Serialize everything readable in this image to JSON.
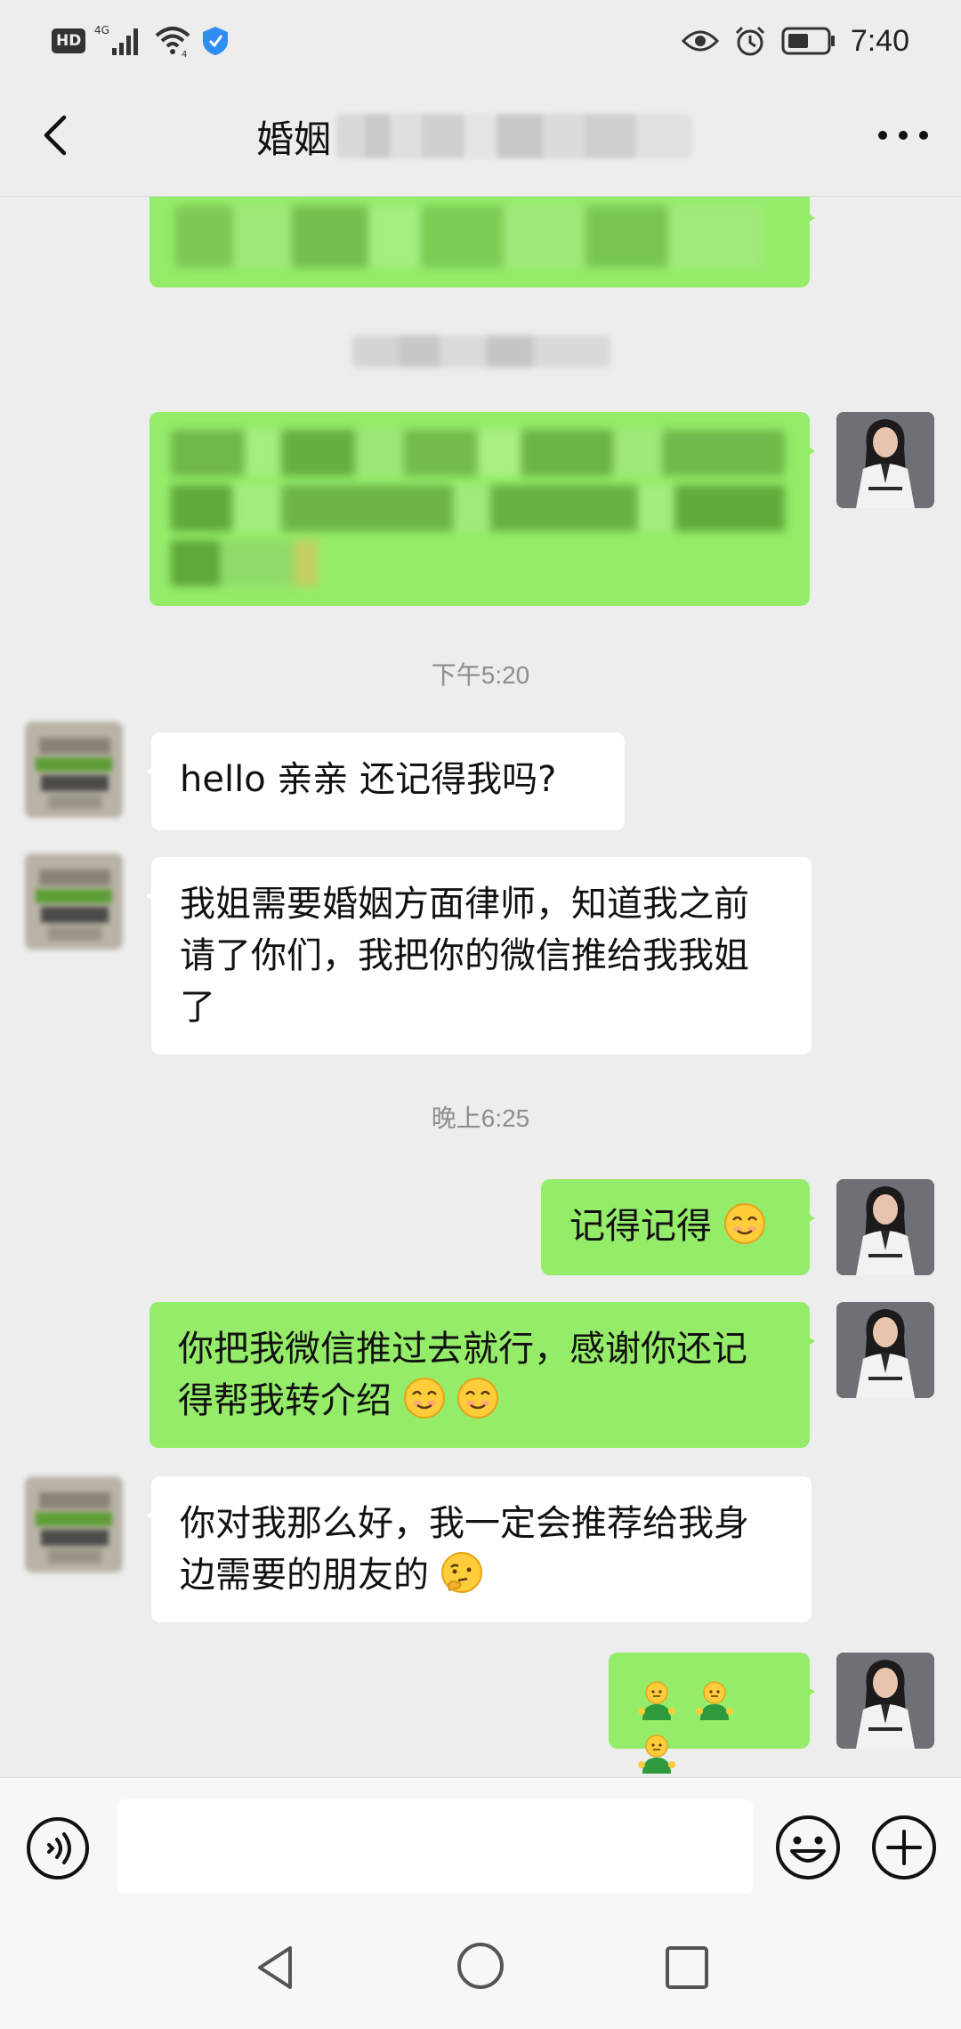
{
  "status_bar": {
    "hd_label": "HD",
    "network_label": "4G",
    "wifi_label": "4",
    "time": "7:40",
    "icons": [
      "hd-icon",
      "signal-icon",
      "wifi-icon",
      "shield-icon",
      "eye-icon",
      "alarm-icon",
      "battery-icon"
    ]
  },
  "header": {
    "title": "婚姻",
    "back_icon": "chevron-left-icon",
    "more_icon": "more-dots-icon"
  },
  "chat": {
    "timestamps": [
      "下午5:20",
      "晚上6:25"
    ],
    "messages": [
      {
        "sender": "me",
        "text": "记得记得"
      },
      {
        "sender": "them",
        "text": "hello 亲亲 还记得我吗?"
      },
      {
        "sender": "them",
        "text": "我姐需要婚姻方面律师，知道我之前请了你们，我把你的微信推给我我姐了"
      },
      {
        "sender": "me",
        "text": "记得记得"
      },
      {
        "sender": "me",
        "text": "你把我微信推过去就行，感谢你还记得帮我转介绍"
      },
      {
        "sender": "them",
        "text": "你对我那么好，我一定会推荐给我身边需要的朋友的"
      },
      {
        "sender": "me",
        "text": ""
      }
    ],
    "emojis": [
      "smile-emoji",
      "thinking-emoji",
      "green-figure-emoji"
    ]
  },
  "input_bar": {
    "voice_icon": "voice-icon",
    "emoji_icon": "emoji-face-icon",
    "plus_icon": "plus-circle-icon",
    "placeholder": ""
  },
  "system_nav": {
    "icons": [
      "nav-back-icon",
      "nav-home-icon",
      "nav-recent-icon"
    ]
  },
  "colors": {
    "my_bubble": "#95ec69",
    "their_bubble": "#ffffff",
    "background": "#ededed"
  }
}
